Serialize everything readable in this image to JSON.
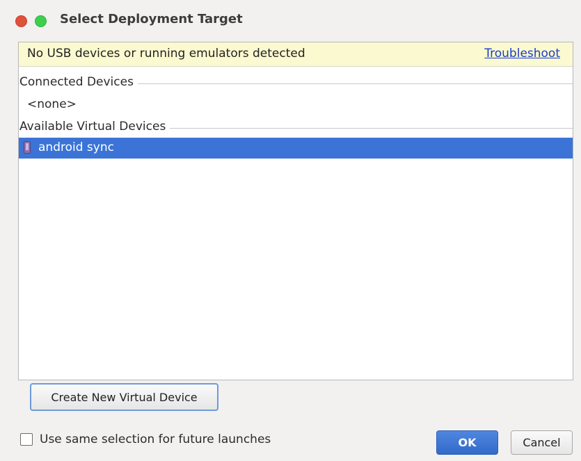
{
  "window": {
    "title": "Select Deployment Target"
  },
  "banner": {
    "message": "No USB devices or running emulators detected",
    "link_label": "Troubleshoot"
  },
  "device_list": {
    "connected_header": "Connected Devices",
    "connected_empty": "<none>",
    "available_header": "Available Virtual Devices",
    "available_devices": [
      {
        "label": "android sync",
        "selected": true,
        "icon": "phone-icon"
      }
    ]
  },
  "actions": {
    "create_device_label": "Create New Virtual Device",
    "same_selection_label": "Use same selection for future launches",
    "same_selection_checked": false,
    "ok_label": "OK",
    "cancel_label": "Cancel"
  },
  "colors": {
    "selection": "#3b74d6",
    "banner_bg": "#fbf9d0",
    "link": "#1a3cc9",
    "close_button": "#e05139",
    "maximize_button": "#3fcf4f"
  }
}
